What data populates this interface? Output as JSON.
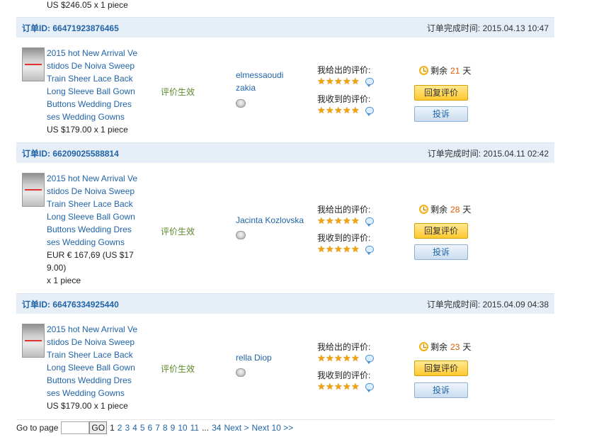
{
  "top_price": "US $246.05 x 1 piece",
  "labels": {
    "order_id": "订单ID:",
    "complete_time": "订单完成时间:",
    "given": "我给出的评价:",
    "received": "我收到的评价:",
    "remaining": "剩余",
    "days": "天",
    "reply_btn": "回复评价",
    "complain_btn": "投诉",
    "status": "评价生效"
  },
  "orders": [
    {
      "id": "66471923876465",
      "time": "2015.04.13 10:47",
      "title": [
        "2015 hot New Arrival Ve",
        "stidos De Noiva Sweep",
        "Train Sheer Lace Back",
        "Long Sleeve Ball Gown",
        "Buttons Wedding Dres",
        "ses Wedding Gowns"
      ],
      "price": [
        "US $179.00 x 1 piece"
      ],
      "buyer": [
        "elmessaoudi",
        "zakia"
      ],
      "days_left": "21",
      "given_stars": 5,
      "received_stars": 5
    },
    {
      "id": "66209025588814",
      "time": "2015.04.11 02:42",
      "title": [
        "2015 hot New Arrival Ve",
        "stidos De Noiva Sweep",
        "Train Sheer Lace Back",
        "Long Sleeve Ball Gown",
        "Buttons Wedding Dres",
        "ses Wedding Gowns"
      ],
      "price": [
        "EUR € 167,69 (US $17",
        "9.00)",
        "x 1 piece"
      ],
      "buyer": [
        "Jacinta Kozlovska"
      ],
      "days_left": "28",
      "given_stars": 5,
      "received_stars": 5
    },
    {
      "id": "66476334925440",
      "time": "2015.04.09 04:38",
      "title": [
        "2015 hot New Arrival Ve",
        "stidos De Noiva Sweep",
        "Train Sheer Lace Back",
        "Long Sleeve Ball Gown",
        "Buttons Wedding Dres",
        "ses Wedding Gowns"
      ],
      "price": [
        "US $179.00 x 1 piece"
      ],
      "buyer": [
        "rella Diop"
      ],
      "days_left": "23",
      "given_stars": 5,
      "received_stars": 5
    }
  ],
  "pager": {
    "label": "Go to page",
    "input_value": "",
    "go": "GO",
    "current": "1",
    "pages": [
      "2",
      "3",
      "4",
      "5",
      "6",
      "7",
      "8",
      "9",
      "10",
      "11"
    ],
    "ellipsis": "...",
    "last": "34",
    "next": "Next >",
    "next10": "Next 10 >>"
  },
  "colors": {
    "header_bg": "#e6eef7",
    "link": "#2164a8",
    "status_green": "#5b8a2a",
    "days_orange": "#e05a00",
    "star": "#f0a30a"
  }
}
